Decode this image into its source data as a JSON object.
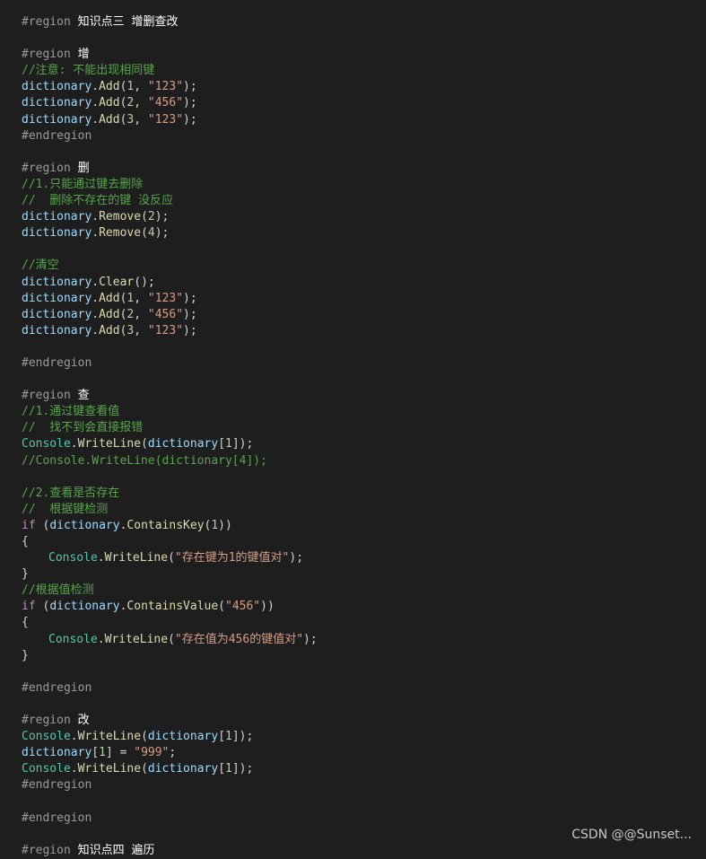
{
  "code": {
    "lines": [
      [
        {
          "t": "#region ",
          "c": "pre"
        },
        {
          "t": "知识点三 增删查改",
          "c": "rt"
        }
      ],
      [],
      [
        {
          "t": "#region ",
          "c": "pre"
        },
        {
          "t": "增",
          "c": "rt"
        }
      ],
      [
        {
          "t": "//注意: 不能出现相同键",
          "c": "cm"
        }
      ],
      [
        {
          "t": "dictionary",
          "c": "var"
        },
        {
          "t": ".",
          "c": "pun"
        },
        {
          "t": "Add",
          "c": "mth"
        },
        {
          "t": "(",
          "c": "pun"
        },
        {
          "t": "1",
          "c": "num"
        },
        {
          "t": ", ",
          "c": "pun"
        },
        {
          "t": "\"123\"",
          "c": "str"
        },
        {
          "t": ");",
          "c": "pun"
        }
      ],
      [
        {
          "t": "dictionary",
          "c": "var"
        },
        {
          "t": ".",
          "c": "pun"
        },
        {
          "t": "Add",
          "c": "mth"
        },
        {
          "t": "(",
          "c": "pun"
        },
        {
          "t": "2",
          "c": "num"
        },
        {
          "t": ", ",
          "c": "pun"
        },
        {
          "t": "\"456\"",
          "c": "str"
        },
        {
          "t": ");",
          "c": "pun"
        }
      ],
      [
        {
          "t": "dictionary",
          "c": "var"
        },
        {
          "t": ".",
          "c": "pun"
        },
        {
          "t": "Add",
          "c": "mth"
        },
        {
          "t": "(",
          "c": "pun"
        },
        {
          "t": "3",
          "c": "num"
        },
        {
          "t": ", ",
          "c": "pun"
        },
        {
          "t": "\"123\"",
          "c": "str"
        },
        {
          "t": ");",
          "c": "pun"
        }
      ],
      [
        {
          "t": "#endregion",
          "c": "pre"
        }
      ],
      [],
      [
        {
          "t": "#region ",
          "c": "pre"
        },
        {
          "t": "删",
          "c": "rt"
        }
      ],
      [
        {
          "t": "//1.只能通过键去删除",
          "c": "cm"
        }
      ],
      [
        {
          "t": "//  删除不存在的键 没反应",
          "c": "cm"
        }
      ],
      [
        {
          "t": "dictionary",
          "c": "var"
        },
        {
          "t": ".",
          "c": "pun"
        },
        {
          "t": "Remove",
          "c": "mth"
        },
        {
          "t": "(",
          "c": "pun"
        },
        {
          "t": "2",
          "c": "num"
        },
        {
          "t": ");",
          "c": "pun"
        }
      ],
      [
        {
          "t": "dictionary",
          "c": "var"
        },
        {
          "t": ".",
          "c": "pun"
        },
        {
          "t": "Remove",
          "c": "mth"
        },
        {
          "t": "(",
          "c": "pun"
        },
        {
          "t": "4",
          "c": "num"
        },
        {
          "t": ");",
          "c": "pun"
        }
      ],
      [],
      [
        {
          "t": "//清空",
          "c": "cm"
        }
      ],
      [
        {
          "t": "dictionary",
          "c": "var"
        },
        {
          "t": ".",
          "c": "pun"
        },
        {
          "t": "Clear",
          "c": "mth"
        },
        {
          "t": "();",
          "c": "pun"
        }
      ],
      [
        {
          "t": "dictionary",
          "c": "var"
        },
        {
          "t": ".",
          "c": "pun"
        },
        {
          "t": "Add",
          "c": "mth"
        },
        {
          "t": "(",
          "c": "pun"
        },
        {
          "t": "1",
          "c": "num"
        },
        {
          "t": ", ",
          "c": "pun"
        },
        {
          "t": "\"123\"",
          "c": "str"
        },
        {
          "t": ");",
          "c": "pun"
        }
      ],
      [
        {
          "t": "dictionary",
          "c": "var"
        },
        {
          "t": ".",
          "c": "pun"
        },
        {
          "t": "Add",
          "c": "mth"
        },
        {
          "t": "(",
          "c": "pun"
        },
        {
          "t": "2",
          "c": "num"
        },
        {
          "t": ", ",
          "c": "pun"
        },
        {
          "t": "\"456\"",
          "c": "str"
        },
        {
          "t": ");",
          "c": "pun"
        }
      ],
      [
        {
          "t": "dictionary",
          "c": "var"
        },
        {
          "t": ".",
          "c": "pun"
        },
        {
          "t": "Add",
          "c": "mth"
        },
        {
          "t": "(",
          "c": "pun"
        },
        {
          "t": "3",
          "c": "num"
        },
        {
          "t": ", ",
          "c": "pun"
        },
        {
          "t": "\"123\"",
          "c": "str"
        },
        {
          "t": ");",
          "c": "pun"
        }
      ],
      [],
      [
        {
          "t": "#endregion",
          "c": "pre"
        }
      ],
      [],
      [
        {
          "t": "#region ",
          "c": "pre"
        },
        {
          "t": "查",
          "c": "rt"
        }
      ],
      [
        {
          "t": "//1.通过键查看值",
          "c": "cm"
        }
      ],
      [
        {
          "t": "//  找不到会直接报错",
          "c": "cm"
        }
      ],
      [
        {
          "t": "Console",
          "c": "cls"
        },
        {
          "t": ".",
          "c": "pun"
        },
        {
          "t": "WriteLine",
          "c": "mth"
        },
        {
          "t": "(",
          "c": "pun"
        },
        {
          "t": "dictionary",
          "c": "var"
        },
        {
          "t": "[",
          "c": "pun"
        },
        {
          "t": "1",
          "c": "num"
        },
        {
          "t": "]);",
          "c": "pun"
        }
      ],
      [
        {
          "t": "//Console.WriteLine(dictionary[4]);",
          "c": "cm"
        }
      ],
      [],
      [
        {
          "t": "//2.查看是否存在",
          "c": "cm"
        }
      ],
      [
        {
          "t": "//  根据键检测",
          "c": "cm"
        }
      ],
      [
        {
          "t": "if",
          "c": "kw"
        },
        {
          "t": " (",
          "c": "pun"
        },
        {
          "t": "dictionary",
          "c": "var"
        },
        {
          "t": ".",
          "c": "pun"
        },
        {
          "t": "ContainsKey",
          "c": "mth"
        },
        {
          "t": "(",
          "c": "pun"
        },
        {
          "t": "1",
          "c": "num"
        },
        {
          "t": "))",
          "c": "pun"
        }
      ],
      [
        {
          "t": "{",
          "c": "pun"
        }
      ],
      [
        {
          "t": "",
          "c": "ind"
        },
        {
          "t": "Console",
          "c": "cls"
        },
        {
          "t": ".",
          "c": "pun"
        },
        {
          "t": "WriteLine",
          "c": "mth"
        },
        {
          "t": "(",
          "c": "pun"
        },
        {
          "t": "\"存在键为1的键值对\"",
          "c": "str"
        },
        {
          "t": ");",
          "c": "pun"
        }
      ],
      [
        {
          "t": "}",
          "c": "pun"
        }
      ],
      [
        {
          "t": "//根据值检测",
          "c": "cm"
        }
      ],
      [
        {
          "t": "if",
          "c": "kw"
        },
        {
          "t": " (",
          "c": "pun"
        },
        {
          "t": "dictionary",
          "c": "var"
        },
        {
          "t": ".",
          "c": "pun"
        },
        {
          "t": "ContainsValue",
          "c": "mth"
        },
        {
          "t": "(",
          "c": "pun"
        },
        {
          "t": "\"456\"",
          "c": "str"
        },
        {
          "t": "))",
          "c": "pun"
        }
      ],
      [
        {
          "t": "{",
          "c": "pun"
        }
      ],
      [
        {
          "t": "",
          "c": "ind"
        },
        {
          "t": "Console",
          "c": "cls"
        },
        {
          "t": ".",
          "c": "pun"
        },
        {
          "t": "WriteLine",
          "c": "mth"
        },
        {
          "t": "(",
          "c": "pun"
        },
        {
          "t": "\"存在值为456的键值对\"",
          "c": "str"
        },
        {
          "t": ");",
          "c": "pun"
        }
      ],
      [
        {
          "t": "}",
          "c": "pun"
        }
      ],
      [],
      [
        {
          "t": "#endregion",
          "c": "pre"
        }
      ],
      [],
      [
        {
          "t": "#region ",
          "c": "pre"
        },
        {
          "t": "改",
          "c": "rt"
        }
      ],
      [
        {
          "t": "Console",
          "c": "cls"
        },
        {
          "t": ".",
          "c": "pun"
        },
        {
          "t": "WriteLine",
          "c": "mth"
        },
        {
          "t": "(",
          "c": "pun"
        },
        {
          "t": "dictionary",
          "c": "var"
        },
        {
          "t": "[",
          "c": "pun"
        },
        {
          "t": "1",
          "c": "num"
        },
        {
          "t": "]);",
          "c": "pun"
        }
      ],
      [
        {
          "t": "dictionary",
          "c": "var"
        },
        {
          "t": "[",
          "c": "pun"
        },
        {
          "t": "1",
          "c": "num"
        },
        {
          "t": "] = ",
          "c": "pun"
        },
        {
          "t": "\"999\"",
          "c": "str"
        },
        {
          "t": ";",
          "c": "pun"
        }
      ],
      [
        {
          "t": "Console",
          "c": "cls"
        },
        {
          "t": ".",
          "c": "pun"
        },
        {
          "t": "WriteLine",
          "c": "mth"
        },
        {
          "t": "(",
          "c": "pun"
        },
        {
          "t": "dictionary",
          "c": "var"
        },
        {
          "t": "[",
          "c": "pun"
        },
        {
          "t": "1",
          "c": "num"
        },
        {
          "t": "]);",
          "c": "pun"
        }
      ],
      [
        {
          "t": "#endregion",
          "c": "pre"
        }
      ],
      [],
      [
        {
          "t": "#endregion",
          "c": "pre"
        }
      ],
      [],
      [
        {
          "t": "#region ",
          "c": "pre"
        },
        {
          "t": "知识点四 遍历",
          "c": "rt"
        }
      ]
    ]
  },
  "watermark": {
    "text": "CSDN @@Sunset..."
  }
}
